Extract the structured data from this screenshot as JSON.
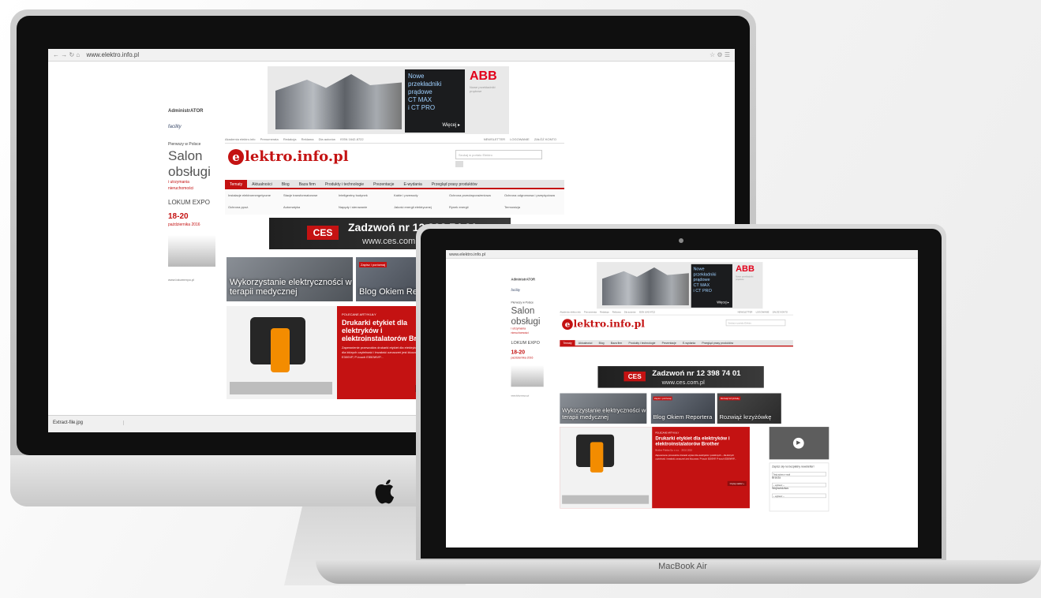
{
  "website": {
    "url": "www.elektro.info.pl",
    "left_ad": {
      "logo_top": "AdministrATOR",
      "logo_sub": "facility",
      "heading": "Pierwszy w Polsce",
      "big_lines": [
        "Salon",
        "obsługi"
      ],
      "small_lines": [
        "i utrzymania",
        "nieruchomości"
      ],
      "expo_name": "LOKUM",
      "expo_sub": "EXPO",
      "dates": "18-20",
      "month": "października 2016",
      "www": "www.lokumexpo.pl"
    },
    "top_ad": {
      "lines": [
        "Nowe",
        "przekładniki",
        "prądowe",
        "CT MAX",
        "i CT PRO"
      ],
      "more": "Więcej ▸",
      "brand": "ABB",
      "brand_sub": "Nowe przekładniki prądowe"
    },
    "toplinks": [
      "Akademia elektro.info",
      "Prenumerata",
      "Redakcja",
      "Reklama",
      "Dla autorów",
      "ISSN 1642-8722"
    ],
    "toplinks_right": [
      "NEWSLETTER",
      "LOGOWANIE",
      "ZAŁÓŻ KONTO"
    ],
    "brand": {
      "mark": "e",
      "name": "lektro.info.pl"
    },
    "search_placeholder": "Szukaj w portalu Elektro",
    "menu": [
      "Tematy",
      "Aktualności",
      "Blog",
      "Baza firm",
      "Produkty i technologie",
      "Prezentacje",
      "E-wydania",
      "Przegląd prasy produktów"
    ],
    "submenu": [
      "Instalacje elektroenergetyczne",
      "Stacje transformatorowe",
      "Inteligentny budynek",
      "Kable i przewody",
      "Ochrona przeciwporażeniowa",
      "Ochrona odgromowa i przepięciowa",
      "Ochrona ppoż.",
      "Automatyka",
      "Napędy i sterowanie",
      "Jakość energii elektrycznej",
      "Rynek energii",
      "Termowizja"
    ],
    "ces": {
      "logo": "CES",
      "phone": "Zadzwoń nr 12 398 74 01",
      "web": "www.ces.com.pl"
    },
    "tiles": [
      {
        "tag": "",
        "caption": "Wykorzystanie elektryczności w terapii medycznej"
      },
      {
        "tag": "Zapisz i porównaj",
        "caption": "Blog Okiem Reportera"
      },
      {
        "tag": "Rozwiąż krzyżówkę",
        "caption": "Rozwiąż krzyżówkę"
      }
    ],
    "feature": {
      "meta": "POLECANE ARTYKUŁY",
      "title": "Drukarki etykiet dla elektryków i elektroinstalatorów Brother",
      "author": "Brother Polska Sp. z o.o. · 28.10.2016",
      "text": "Zapewnienie przewodów drukarki etykiet dla elektryków i podobnych – dla których czytelność i trwałość oznaczeń jest kluczowa. P-touch E300VP, P-touch E550WVP...",
      "button": "Czytaj całość »"
    },
    "newsletter": {
      "title": "Zapisz się na bezpłatny newsletter!",
      "email_label": "Twój adres e-mail",
      "branch_label": "Branża",
      "branch_value": "-- wybierz --",
      "voivode_label": "Województwo",
      "voivode_value": "-- wybierz --"
    }
  },
  "imac": {
    "taskbar_file": "Extract-file.jpg"
  },
  "macbook": {
    "label": "MacBook Air"
  }
}
